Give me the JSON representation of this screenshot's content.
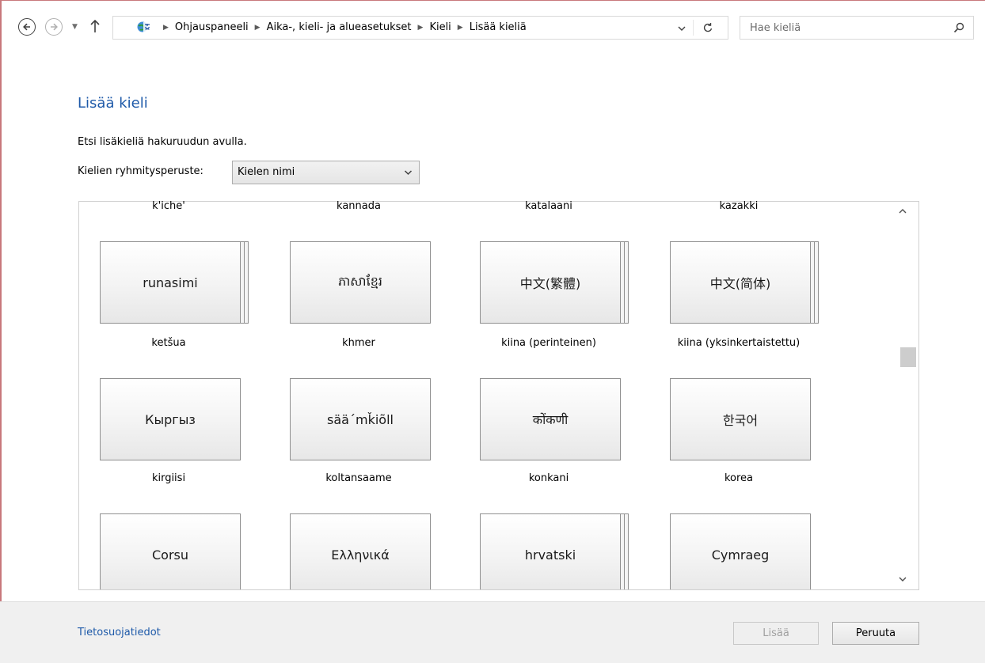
{
  "nav": {
    "back_icon": "back-arrow-icon",
    "forward_icon": "forward-arrow-icon",
    "breadcrumbs": [
      "Ohjauspaneeli",
      "Aika-, kieli- ja alueasetukset",
      "Kieli",
      "Lisää kieliä"
    ],
    "search_placeholder": "Hae kieliä"
  },
  "main": {
    "title": "Lisää kieli",
    "description": "Etsi lisäkieliä hakuruudun avulla.",
    "group_label": "Kielien ryhmitysperuste:",
    "group_value": "Kielen nimi"
  },
  "top_row_captions": [
    "k'iche'",
    "kannada",
    "katalaani",
    "kazakki"
  ],
  "rows": [
    [
      {
        "native": "runasimi",
        "name": "ketšua"
      },
      {
        "native": "ភាសាខ្មែរ",
        "name": "khmer"
      },
      {
        "native": "中文(繁體)",
        "name": "kiina (perinteinen)"
      },
      {
        "native": "中文(简体)",
        "name": "kiina (yksinkertaistettu)"
      }
    ],
    [
      {
        "native": "Кыргыз",
        "name": "kirgiisi"
      },
      {
        "native": "sää´mǩiõll",
        "name": "koltansaame"
      },
      {
        "native": "कोंकणी",
        "name": "konkani"
      },
      {
        "native": "한국어",
        "name": "korea"
      }
    ],
    [
      {
        "native": "Corsu"
      },
      {
        "native": "Ελληνικά"
      },
      {
        "native": "hrvatski"
      },
      {
        "native": "Cymraeg"
      }
    ]
  ],
  "footer": {
    "privacy_link": "Tietosuojatiedot",
    "add_button": "Lisää",
    "cancel_button": "Peruuta"
  }
}
